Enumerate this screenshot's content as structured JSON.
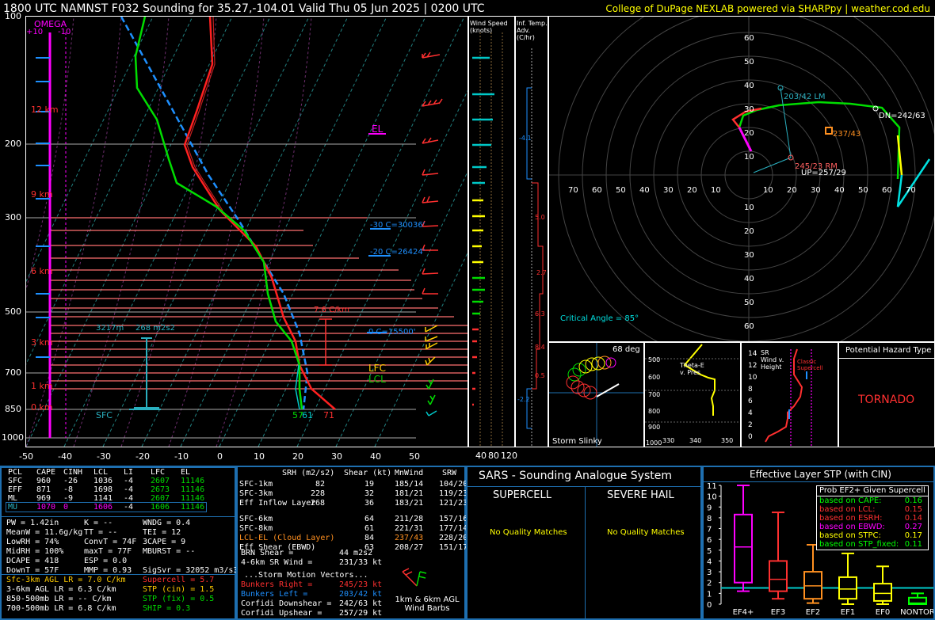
{
  "header": {
    "title": "1800 UTC NAMNST F032 Sounding for 35.27,-104.01 Valid  Thu 05 Jun 2025 | 0200 UTC",
    "credit": "College of DuPage NEXLAB powered via SHARPpy | weather.cod.edu"
  },
  "skewt": {
    "pressure_labels": [
      "100",
      "200",
      "300",
      "500",
      "700",
      "850",
      "1000"
    ],
    "temp_labels": [
      "-50",
      "-40",
      "-30",
      "-20",
      "-10",
      "0",
      "10",
      "20",
      "30",
      "40",
      "50"
    ],
    "height_labels": [
      "12 km",
      "9 km",
      "6 km",
      "3 km",
      "1 km",
      "0 km"
    ],
    "omega_label": "OMEGA",
    "omega_ticks": [
      "+10",
      "-10"
    ],
    "el_label": "EL",
    "lfc_label": "LFC",
    "lcl_label": "LCL",
    "iso30": "-30 C=30036'",
    "iso20": "-20 C=26424'",
    "iso0": "0 C=15500'",
    "lapse": "7.6 C/km",
    "effective_depth": "3217m",
    "effective_srh": "268 m2s2",
    "sfc_label": "SFC",
    "sfc_td": "57",
    "sfc_tw": "61",
    "sfc_t": "71"
  },
  "wind_speed_panel": {
    "title": "Wind Speed (knots)",
    "ticks": [
      "40",
      "80",
      "120"
    ]
  },
  "temp_adv_panel": {
    "title": "Inf. Temp. Adv. (C/hr)",
    "values": [
      "-4.1",
      "5.0",
      "2.7",
      "6.3",
      "8.4",
      "0.5",
      "-2.2"
    ]
  },
  "hodograph": {
    "ring_labels": [
      "70",
      "60",
      "50",
      "40",
      "30",
      "20",
      "10"
    ],
    "lm": "203/42 LM",
    "rm": "245/23 RM",
    "dn": "DN=242/63",
    "up": "UP=257/29",
    "mean": "237/43",
    "critical_angle": "Critical Angle = 85°"
  },
  "slinky": {
    "title": "Storm Slinky",
    "angle": "68 deg"
  },
  "theta": {
    "title": "Theta-E v. Pres",
    "y": [
      "500",
      "600",
      "700",
      "800",
      "900",
      "1000"
    ],
    "x": [
      "330",
      "340",
      "350"
    ]
  },
  "srwind": {
    "title": "SR Wind v. Height",
    "y": [
      "14",
      "12",
      "10",
      "8",
      "6",
      "4",
      "2",
      "0"
    ],
    "note": "Classic Supercell"
  },
  "hazard": {
    "title": "Potential Hazard Type",
    "value": "TORNADO"
  },
  "parcels": {
    "headers": [
      "PCL",
      "CAPE",
      "CINH",
      "LCL",
      "LI",
      "LFC",
      "EL"
    ],
    "rows": [
      [
        "SFC",
        "960",
        "-26",
        "1036",
        "-4",
        "2607",
        "11146"
      ],
      [
        "EFF",
        "871",
        "-8",
        "1698",
        "-4",
        "2673",
        "11146"
      ],
      [
        "ML",
        "969",
        "-9",
        "1141",
        "-4",
        "2607",
        "11146"
      ],
      [
        "MU",
        "1070",
        "0",
        "1606",
        "-4",
        "1606",
        "11146"
      ]
    ]
  },
  "indices": {
    "col1": [
      "PW = 1.42in",
      "MeanW = 11.6g/kg",
      "LowRH = 74%",
      "MidRH = 100%",
      "DCAPE = 418",
      "DownT = 57F"
    ],
    "col2": [
      "K = --",
      "TT = --",
      "ConvT = 74F",
      "maxT = 77F",
      "ESP = 0.0",
      "MMP = 0.93"
    ],
    "col3": [
      "WNDG = 0.4",
      "TEI = 12",
      "3CAPE = 9",
      "MBURST = --",
      "",
      ""
    ],
    "sigsvr": "SigSvr = 32052 m3/s3",
    "lapse": [
      "Sfc-3km AGL LR = 7.0 C/km",
      "3-6km AGL LR = 6.3 C/km",
      "850-500mb LR = -- C/km",
      "700-500mb LR = 6.8 C/km"
    ],
    "params": [
      "Supercell = 5.7",
      "STP (cin) = 1.5",
      "STP (fix) = 0.5",
      "SHIP = 0.3"
    ]
  },
  "kinematics": {
    "headers": [
      "SRH (m2/s2)",
      "Shear (kt)",
      "MnWind",
      "SRW"
    ],
    "rows": [
      [
        "SFC-1km",
        "82",
        "19",
        "185/14",
        "104/20"
      ],
      [
        "SFC-3km",
        "228",
        "32",
        "181/21",
        "119/23"
      ],
      [
        "Eff Inflow Layer",
        "268",
        "36",
        "183/21",
        "121/23"
      ],
      [
        "",
        "",
        "",
        "",
        ""
      ],
      [
        "SFC-6km",
        "",
        "64",
        "211/28",
        "157/16"
      ],
      [
        "SFC-8km",
        "",
        "61",
        "221/31",
        "177/14"
      ],
      [
        "LCL-EL (Cloud Layer)",
        "",
        "84",
        "237/43",
        "228/20"
      ],
      [
        "Eff Shear (EBWD)",
        "",
        "63",
        "208/27",
        "151/17"
      ]
    ],
    "brn_shear": "BRN Shear =",
    "brn_val": "44 m2s2",
    "sr46": "4-6km SR Wind =",
    "sr46_val": "231/33 kt",
    "sm_title": "...Storm Motion Vectors...",
    "sm": [
      [
        "Bunkers Right =",
        "245/23 kt"
      ],
      [
        "Bunkers Left =",
        "203/42 kt"
      ],
      [
        "Corfidi Downshear =",
        "242/63 kt"
      ],
      [
        "Corfidi Upshear =",
        "257/29 kt"
      ]
    ],
    "barb_label": "1km & 6km AGL Wind Barbs"
  },
  "sars": {
    "title": "SARS - Sounding Analogue System",
    "supercell": "SUPERCELL",
    "hail": "SEVERE HAIL",
    "nomatch": "No Quality Matches"
  },
  "stp": {
    "title": "Effective Layer STP (with CIN)",
    "prob_title": "Prob EF2+ Given Supercell",
    "probs": [
      {
        "label": "based on CAPE:",
        "value": "0.16",
        "color": "#00ff00"
      },
      {
        "label": "based on LCL:",
        "value": "0.15",
        "color": "#ff3030"
      },
      {
        "label": "based on ESRH:",
        "value": "0.14",
        "color": "#ff3030"
      },
      {
        "label": "based on EBWD:",
        "value": "0.27",
        "color": "#ff00ff"
      },
      {
        "label": "based on STPC:",
        "value": "0.17",
        "color": "#ffff00"
      },
      {
        "label": "based on STP_fixed:",
        "value": "0.11",
        "color": "#00ff00"
      }
    ],
    "y_ticks": [
      "11",
      "10",
      "9",
      "8",
      "7",
      "6",
      "5",
      "4",
      "3",
      "2",
      "1",
      "0"
    ],
    "categories": [
      "EF4+",
      "EF3",
      "EF2",
      "EF1",
      "EF0",
      "NONTOR"
    ]
  },
  "chart_data": {
    "type": "box",
    "title": "Effective Layer STP (with CIN)",
    "categories": [
      "EF4+",
      "EF3",
      "EF2",
      "EF1",
      "EF0",
      "NONTOR"
    ],
    "series": [
      {
        "name": "EF4+",
        "whisker_low": 1.2,
        "q1": 2.0,
        "median": 5.3,
        "q3": 8.3,
        "whisker_high": 11.0,
        "color": "#ff00ff"
      },
      {
        "name": "EF3",
        "whisker_low": 0.5,
        "q1": 1.2,
        "median": 2.3,
        "q3": 4.0,
        "whisker_high": 8.5,
        "color": "#ff3030"
      },
      {
        "name": "EF2",
        "whisker_low": 0.1,
        "q1": 0.5,
        "median": 1.7,
        "q3": 3.0,
        "whisker_high": 5.5,
        "color": "#ff9020"
      },
      {
        "name": "EF1",
        "whisker_low": 0.0,
        "q1": 0.5,
        "median": 1.4,
        "q3": 2.5,
        "whisker_high": 4.7,
        "color": "#ffff00"
      },
      {
        "name": "EF0",
        "whisker_low": 0.0,
        "q1": 0.3,
        "median": 1.0,
        "q3": 1.9,
        "whisker_high": 3.5,
        "color": "#ffff00"
      },
      {
        "name": "NONTOR",
        "whisker_low": 0.0,
        "q1": 0.0,
        "median": 0.1,
        "q3": 0.6,
        "whisker_high": 1.0,
        "color": "#00ff00"
      }
    ],
    "current_value": 1.5,
    "ylim": [
      0,
      11
    ]
  },
  "colors": {
    "accent_blue": "#1e6fb0",
    "temp": "#ff3030",
    "dewp": "#00dd00",
    "parcel": "#1e90ff"
  }
}
